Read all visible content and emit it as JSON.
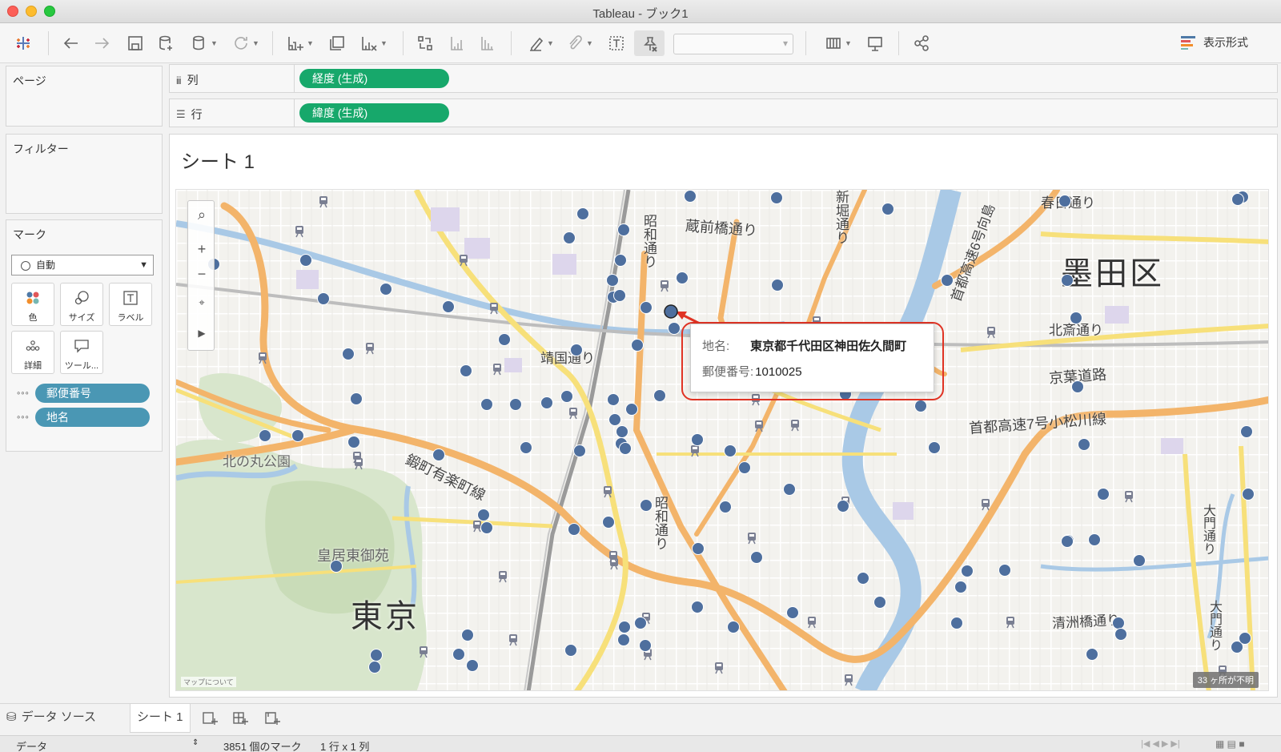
{
  "window": {
    "title": "Tableau - ブック1"
  },
  "toolbar": {
    "show_me_label": "表示形式"
  },
  "pages_card": {
    "title": "ページ"
  },
  "filters_card": {
    "title": "フィルター"
  },
  "marks_card": {
    "title": "マーク",
    "mark_type": "自動",
    "buttons": [
      "色",
      "サイズ",
      "ラベル",
      "詳細",
      "ツール..."
    ],
    "fields": [
      "郵便番号",
      "地名"
    ]
  },
  "shelves": {
    "columns": {
      "label": "列",
      "pill": "経度 (生成)"
    },
    "rows": {
      "label": "行",
      "pill": "緯度 (生成)"
    }
  },
  "sheet": {
    "title": "シート 1"
  },
  "map": {
    "labels": {
      "sumida": "墨田区",
      "tokyo": "東京",
      "kitanomaru": "北の丸公園",
      "kokyo_higashi": "皇居東御苑",
      "yasukuni": "靖国通り",
      "shoma_upper": "昭和通り",
      "shoma_lower": "昭和通り",
      "kuramae": "蔵前橋通り",
      "shinkan": "新堀通り",
      "kasuga": "春日通り",
      "kitasawa": "北斎通り",
      "keiyo": "京葉道路",
      "komatsugawa": "首都高速7号小松川線",
      "mukojima": "首都高速6号向島",
      "kiyosubashi": "清洲橋通り",
      "daimon1": "大門通り",
      "daimon2": "大門通り",
      "kajibashi": "鍛町有楽町線"
    },
    "attribution": "マップについて",
    "unknown_locations": "33 ヶ所が不明",
    "tooltip": {
      "place_label": "地名:",
      "place_value": "東京都千代田区神田佐久間町",
      "zip_label": "郵便番号:",
      "zip_value": "1010025"
    },
    "accent_color": "#4e6f9e"
  },
  "bottom_tabs": {
    "data_source": "データ ソース",
    "sheet": "シート 1"
  },
  "status": {
    "data": "データ",
    "marks": "3851 個のマーク",
    "dims": "1 行 x 1 列"
  }
}
